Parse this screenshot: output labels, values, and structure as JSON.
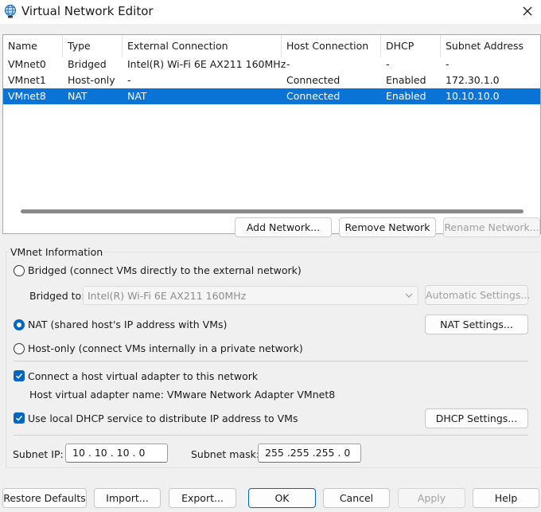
{
  "window": {
    "title": "Virtual Network Editor"
  },
  "network_list": {
    "columns": [
      "Name",
      "Type",
      "External Connection",
      "Host Connection",
      "DHCP",
      "Subnet Address"
    ],
    "rows": [
      [
        "VMnet0",
        "Bridged",
        "Intel(R) Wi-Fi 6E AX211 160MHz",
        "-",
        "-",
        "-"
      ],
      [
        "VMnet1",
        "Host-only",
        "-",
        "Connected",
        "Enabled",
        "172.30.1.0"
      ],
      [
        "VMnet8",
        "NAT",
        "NAT",
        "Connected",
        "Enabled",
        "10.10.10.0"
      ]
    ],
    "selected_index": 2
  },
  "list_buttons": {
    "add": "Add Network...",
    "remove": "Remove Network",
    "rename": "Rename Network..."
  },
  "vmnet_info": {
    "title": "VMnet Information",
    "bridged_label": "Bridged (connect VMs directly to the external network)",
    "bridged_to_label": "Bridged to:",
    "bridged_to_value": "Intel(R) Wi-Fi 6E AX211 160MHz",
    "automatic_settings": "Automatic Settings...",
    "nat_label": "NAT (shared host's IP address with VMs)",
    "nat_settings": "NAT Settings...",
    "hostonly_label": "Host-only (connect VMs internally in a private network)",
    "selected_mode": "nat",
    "connect_adapter_label": "Connect a host virtual adapter to this network",
    "connect_adapter_checked": true,
    "adapter_name_text": "Host virtual adapter name: VMware Network Adapter VMnet8",
    "dhcp_label": "Use local DHCP service to distribute IP address to VMs",
    "dhcp_checked": true,
    "dhcp_settings": "DHCP Settings...",
    "subnet_ip_label": "Subnet IP:",
    "subnet_ip": "10 . 10 . 10 . 0",
    "subnet_mask_label": "Subnet mask:",
    "subnet_mask": "255 .255 .255 . 0"
  },
  "footer": {
    "restore": "Restore Defaults",
    "import": "Import...",
    "export": "Export...",
    "ok": "OK",
    "cancel": "Cancel",
    "apply": "Apply",
    "help": "Help"
  },
  "colors": {
    "selection": "#0a74d6",
    "accent": "#0067c0",
    "dialog_bg": "#f0f0f0"
  }
}
